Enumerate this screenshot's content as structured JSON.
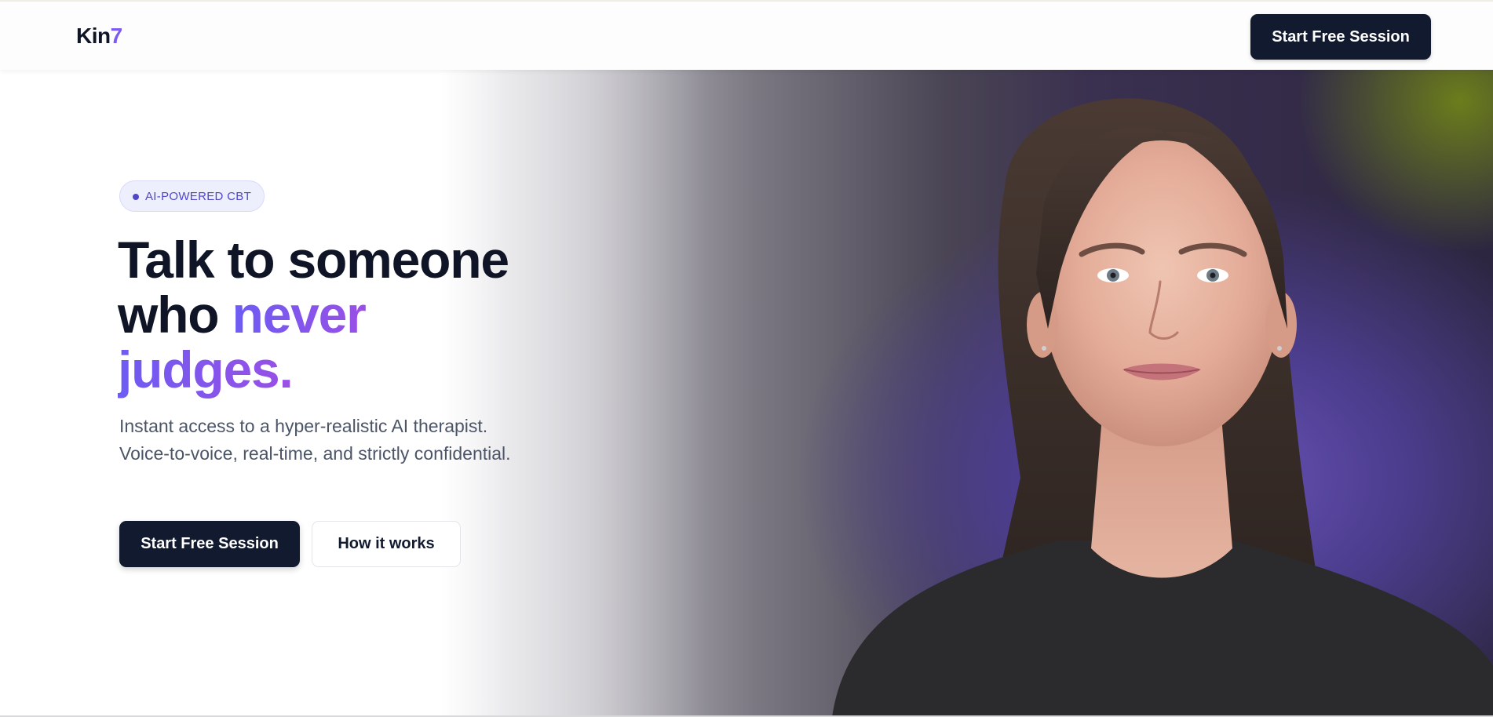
{
  "nav": {
    "logo_text": "Kin",
    "logo_accent": "7",
    "cta_label": "Start Free Session"
  },
  "hero": {
    "badge": "AI-POWERED CBT",
    "headline_line1": "Talk to someone",
    "headline_line2_plain": "who ",
    "headline_line2_highlight": "never",
    "headline_line3_highlight": "judges.",
    "subtext": "Instant access to a hyper-realistic AI therapist. Voice-to-voice, real-time, and strictly confidential.",
    "primary_cta": "Start Free Session",
    "secondary_cta": "How it works"
  },
  "colors": {
    "primary_dark": "#111a2e",
    "accent_purple": "#8a5cf0",
    "badge_text": "#4f46c8",
    "body_text": "#4b5567"
  },
  "icons": {
    "badge_dot": "dot-icon"
  }
}
